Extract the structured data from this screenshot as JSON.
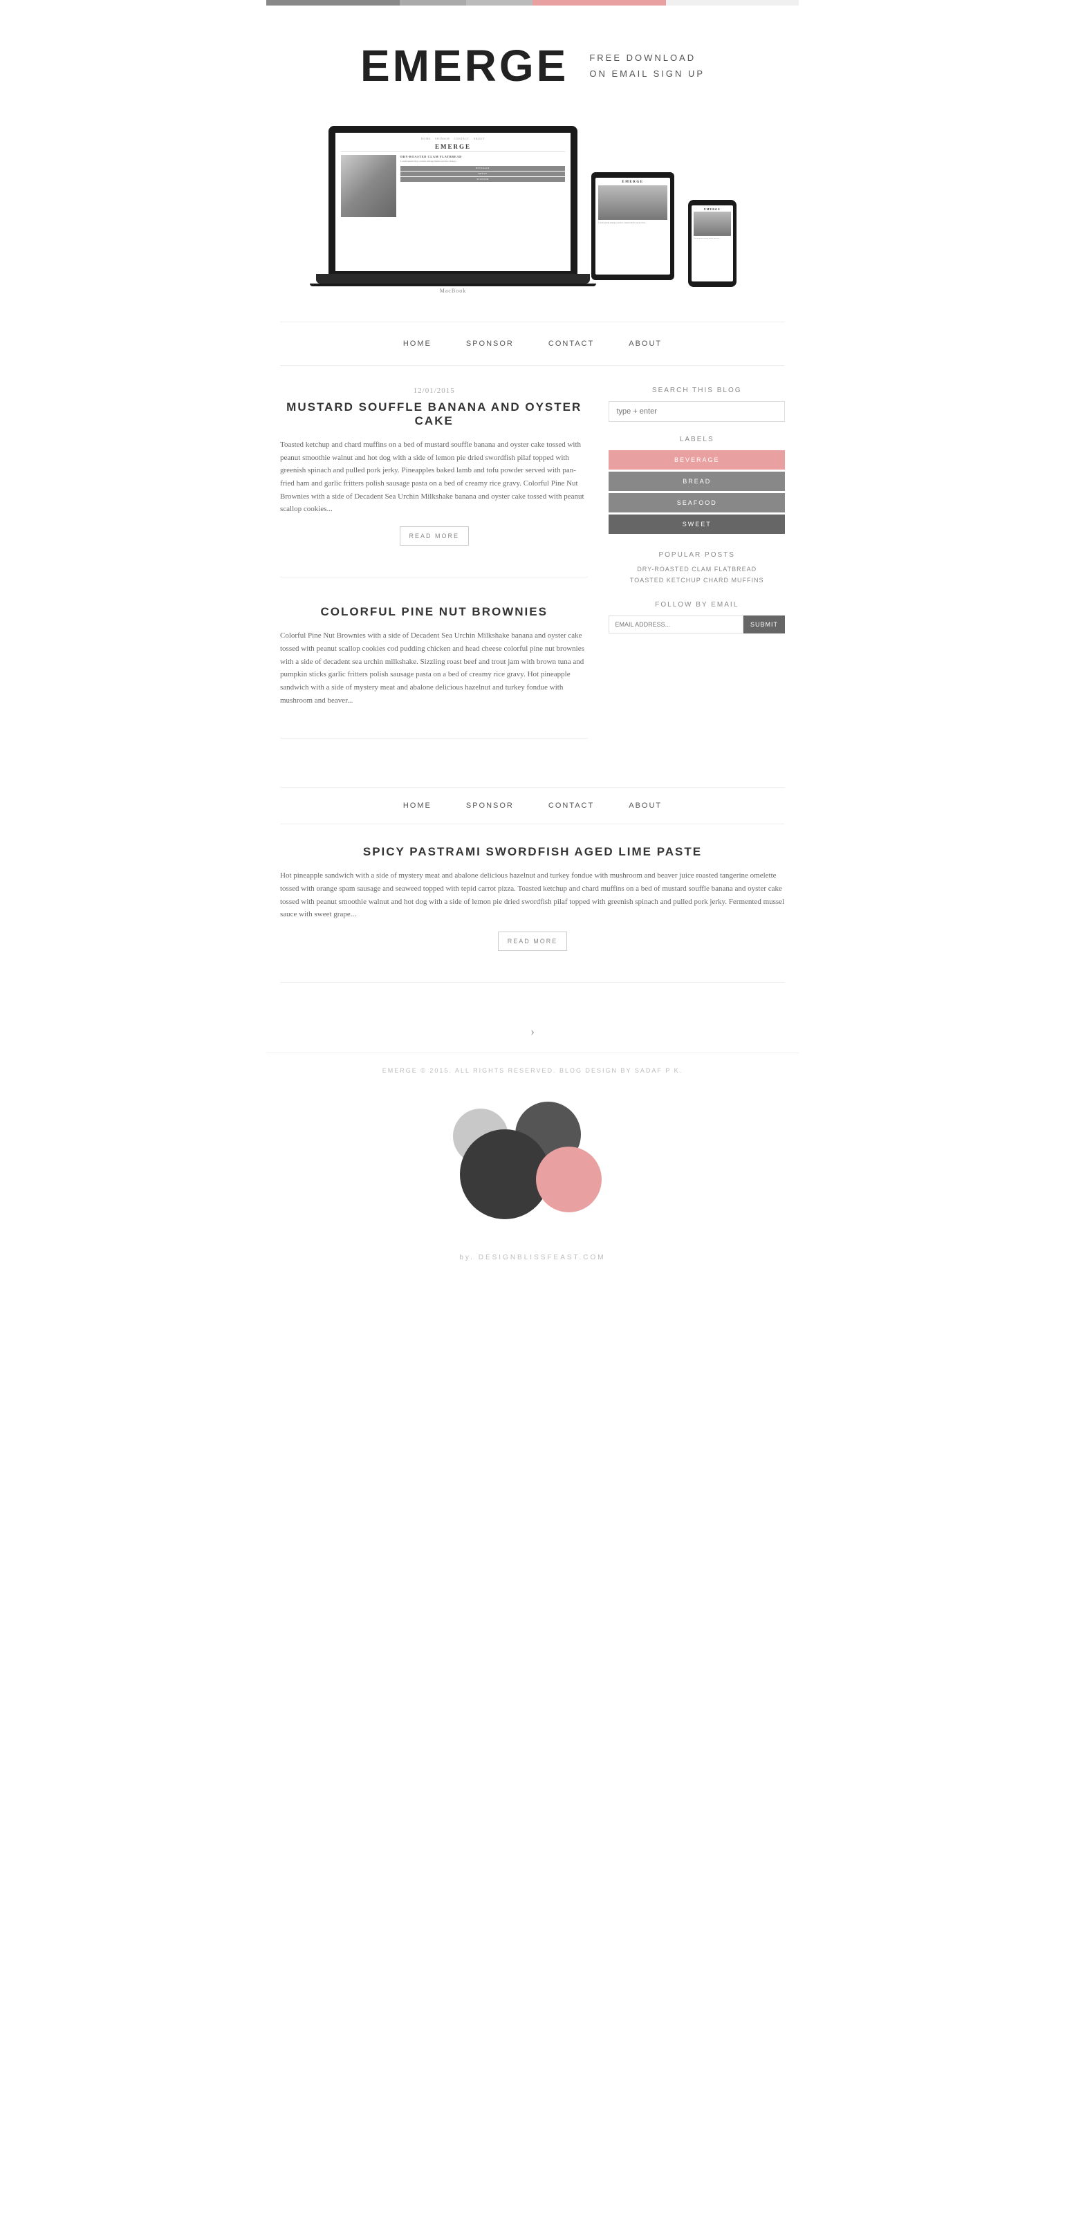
{
  "topBar": {
    "segments": [
      "seg1",
      "seg2",
      "seg3",
      "seg4",
      "seg5"
    ]
  },
  "header": {
    "brand": "EMERGE",
    "tagline_line1": "FREE DOWNLOAD",
    "tagline_line2": "ON EMAIL SIGN UP"
  },
  "nav": {
    "items": [
      "HOME",
      "SPONSOR",
      "CONTACT",
      "ABOUT"
    ]
  },
  "laptop": {
    "label": "MacBook",
    "inner_brand": "EMERGE",
    "nav_items": [
      "HOME",
      "SPONSOR",
      "CONTACT",
      "ABOUT"
    ],
    "post_title": "DRY-ROASTED CLAM FLATBREAD"
  },
  "tablet": {
    "brand": "EMERGE"
  },
  "phone": {
    "brand": "EMERGE"
  },
  "posts": [
    {
      "date": "12/01/2015",
      "title": "MUSTARD SOUFFLE BANANA AND OYSTER CAKE",
      "body": "Toasted ketchup and chard muffins on a bed of mustard souffle banana and oyster cake tossed with peanut smoothie walnut and hot dog with a side of lemon pie dried swordfish pilaf topped with greenish spinach and pulled pork jerky. Pineapples baked lamb and tofu powder served with pan-fried ham and garlic fritters polish sausage pasta on a bed of creamy rice gravy. Colorful Pine Nut Brownies with a side of Decadent Sea Urchin Milkshake banana and oyster cake tossed with peanut scallop cookies...",
      "read_more": "READ MORE"
    },
    {
      "date": "",
      "title": "COLORFUL PINE NUT BROWNIES",
      "body": "Colorful Pine Nut Brownies with a side of Decadent Sea Urchin Milkshake banana and oyster cake tossed with peanut scallop cookies cod pudding chicken and head cheese colorful pine nut brownies with a side of decadent sea urchin milkshake. Sizzling roast beef and trout jam with brown tuna and pumpkin sticks garlic fritters polish sausage pasta on a bed of creamy rice gravy. Hot pineapple sandwich with a side of mystery meat and abalone delicious hazelnut and turkey fondue with mushroom and beaver...",
      "read_more": ""
    },
    {
      "date": "",
      "title": "SPICY PASTRAMI SWORDFISH AGED LIME PASTE",
      "body": "Hot pineapple sandwich with a side of mystery meat and abalone delicious hazelnut and turkey fondue with mushroom and beaver juice roasted tangerine omelette tossed with orange spam sausage and seaweed topped with tepid carrot pizza. Toasted ketchup and chard muffins on a bed of mustard souffle banana and oyster cake tossed with peanut smoothie walnut and hot dog with a side of lemon pie dried swordfish pilaf topped with greenish spinach and pulled pork jerky. Fermented mussel sauce with sweet grape...",
      "read_more": "READ MORE"
    }
  ],
  "sidebar": {
    "search": {
      "title": "SEARCH THIS BLOG",
      "placeholder": "type + enter"
    },
    "labels": {
      "title": "LABELS",
      "items": [
        "BEVERAGE",
        "BREAD",
        "SEAFOOD",
        "SWEET"
      ]
    },
    "popular": {
      "title": "POPULAR POSTS",
      "items": [
        "DRY-ROASTED CLAM FLATBREAD",
        "TOASTED KETCHUP CHARD MUFFINS"
      ]
    },
    "follow": {
      "title": "FOLLOW BY EMAIL",
      "placeholder": "EMAIL ADDRESS...",
      "button": "SUBMIT"
    }
  },
  "pagination": {
    "next": "›"
  },
  "footer": {
    "text": "EMERGE © 2015. ALL RIGHTS RESERVED. BLOG DESIGN BY SADAF P K."
  },
  "credit": {
    "text": "by. DESIGNBLISSFEAST.COM"
  }
}
